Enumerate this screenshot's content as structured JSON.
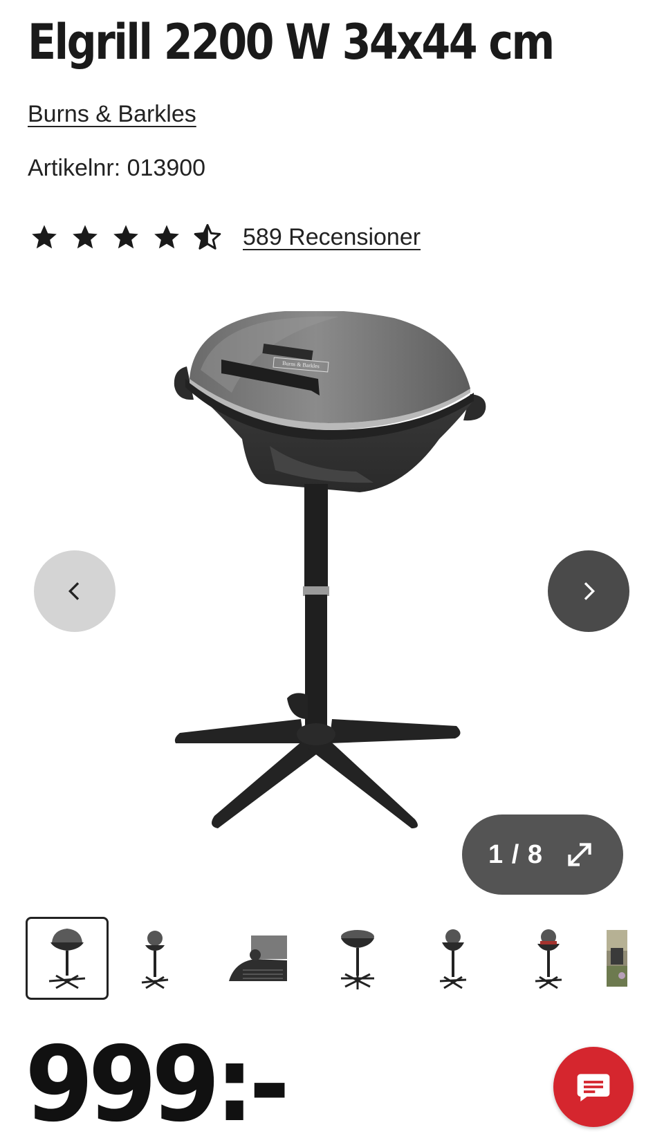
{
  "product": {
    "title": "Elgrill 2200 W 34x44 cm",
    "brand": "Burns & Barkles",
    "article_number": "Artikelnr: 013900",
    "price": "999:-"
  },
  "rating": {
    "stars": 4.5,
    "max_stars": 5,
    "reviews_label": "589 Recensioner"
  },
  "gallery": {
    "counter": "1 / 8",
    "image_logo_text": "Burns & Barkles",
    "thumbnails": [
      {
        "name": "thumb-grill-front",
        "active": true
      },
      {
        "name": "thumb-grill-open",
        "active": false
      },
      {
        "name": "thumb-grill-closeup",
        "active": false
      },
      {
        "name": "thumb-grill-top",
        "active": false
      },
      {
        "name": "thumb-grill-side",
        "active": false
      },
      {
        "name": "thumb-grill-food",
        "active": false
      },
      {
        "name": "thumb-grill-lifestyle",
        "active": false
      }
    ]
  },
  "colors": {
    "chat_red": "#d5262e",
    "nav_prev_bg": "#d4d4d4",
    "nav_next_bg": "#4a4a4a",
    "counter_bg": "#545454"
  },
  "icons": {
    "prev": "chevron-left-icon",
    "next": "chevron-right-icon",
    "expand": "expand-arrows-icon",
    "chat": "chat-bubble-icon"
  }
}
